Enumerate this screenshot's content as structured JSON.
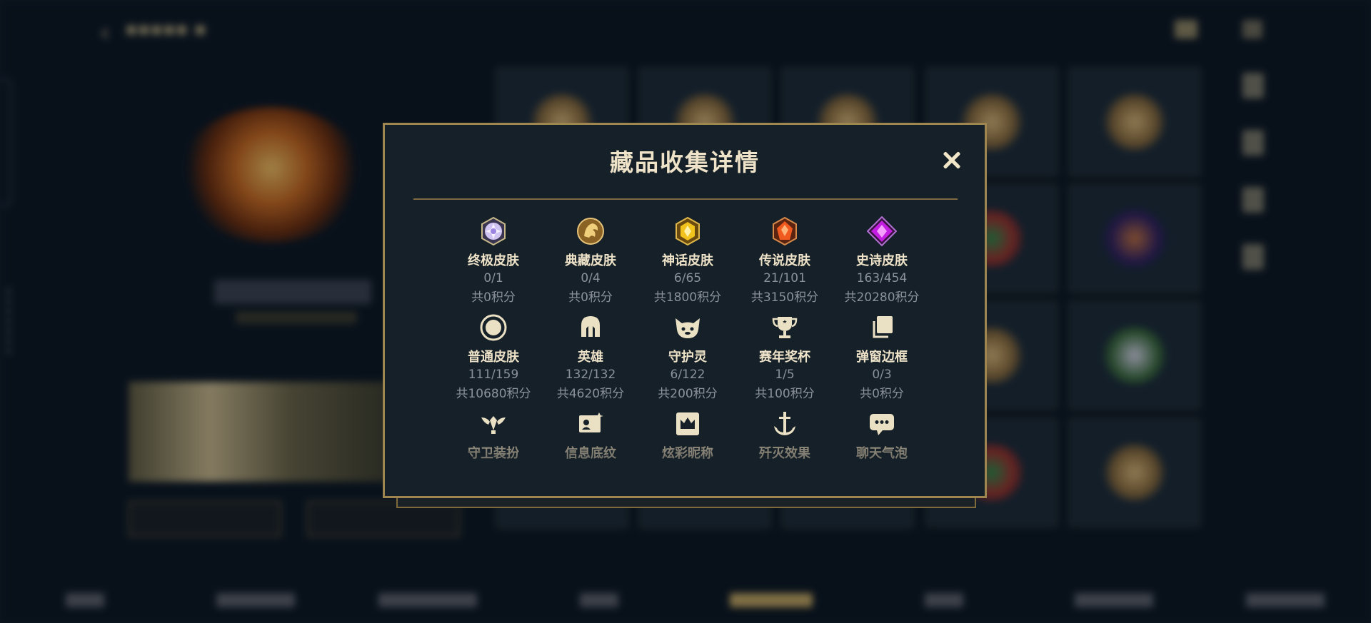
{
  "modal": {
    "title": "藏品收集详情",
    "close_icon": "close-icon",
    "items": [
      {
        "id": "ultimate",
        "icon": "ultimate-gem-icon",
        "name": "终极皮肤",
        "count": "0/1",
        "points": "共0积分"
      },
      {
        "id": "prestige",
        "icon": "prestige-crest-icon",
        "name": "典藏皮肤",
        "count": "0/4",
        "points": "共0积分"
      },
      {
        "id": "mythic",
        "icon": "mythic-gem-icon",
        "name": "神话皮肤",
        "count": "6/65",
        "points": "共1800积分"
      },
      {
        "id": "legendary",
        "icon": "legendary-gem-icon",
        "name": "传说皮肤",
        "count": "21/101",
        "points": "共3150积分"
      },
      {
        "id": "epic",
        "icon": "epic-gem-icon",
        "name": "史诗皮肤",
        "count": "163/454",
        "points": "共20280积分"
      },
      {
        "id": "regular",
        "icon": "regular-ring-icon",
        "name": "普通皮肤",
        "count": "111/159",
        "points": "共10680积分"
      },
      {
        "id": "champion",
        "icon": "champion-helmet-icon",
        "name": "英雄",
        "count": "132/132",
        "points": "共4620积分"
      },
      {
        "id": "guardian",
        "icon": "guardian-creature-icon",
        "name": "守护灵",
        "count": "6/122",
        "points": "共200积分"
      },
      {
        "id": "trophy",
        "icon": "trophy-icon",
        "name": "赛年奖杯",
        "count": "1/5",
        "points": "共100积分"
      },
      {
        "id": "frame",
        "icon": "popup-frame-icon",
        "name": "弹窗边框",
        "count": "0/3",
        "points": "共0积分"
      },
      {
        "id": "guard-outfit",
        "icon": "winged-guard-icon",
        "name": "守卫装扮"
      },
      {
        "id": "info-bg",
        "icon": "info-card-icon",
        "name": "信息底纹"
      },
      {
        "id": "nickname",
        "icon": "crown-badge-icon",
        "name": "炫彩昵称"
      },
      {
        "id": "ace-effect",
        "icon": "anchor-sword-icon",
        "name": "歼灭效果"
      },
      {
        "id": "chat-bubble",
        "icon": "chat-bubble-icon",
        "name": "聊天气泡"
      }
    ]
  },
  "colors": {
    "accent_gold": "#9f8650",
    "title_text": "#eee3c8",
    "muted_text": "#8b9199",
    "modal_bg": "#162028"
  }
}
